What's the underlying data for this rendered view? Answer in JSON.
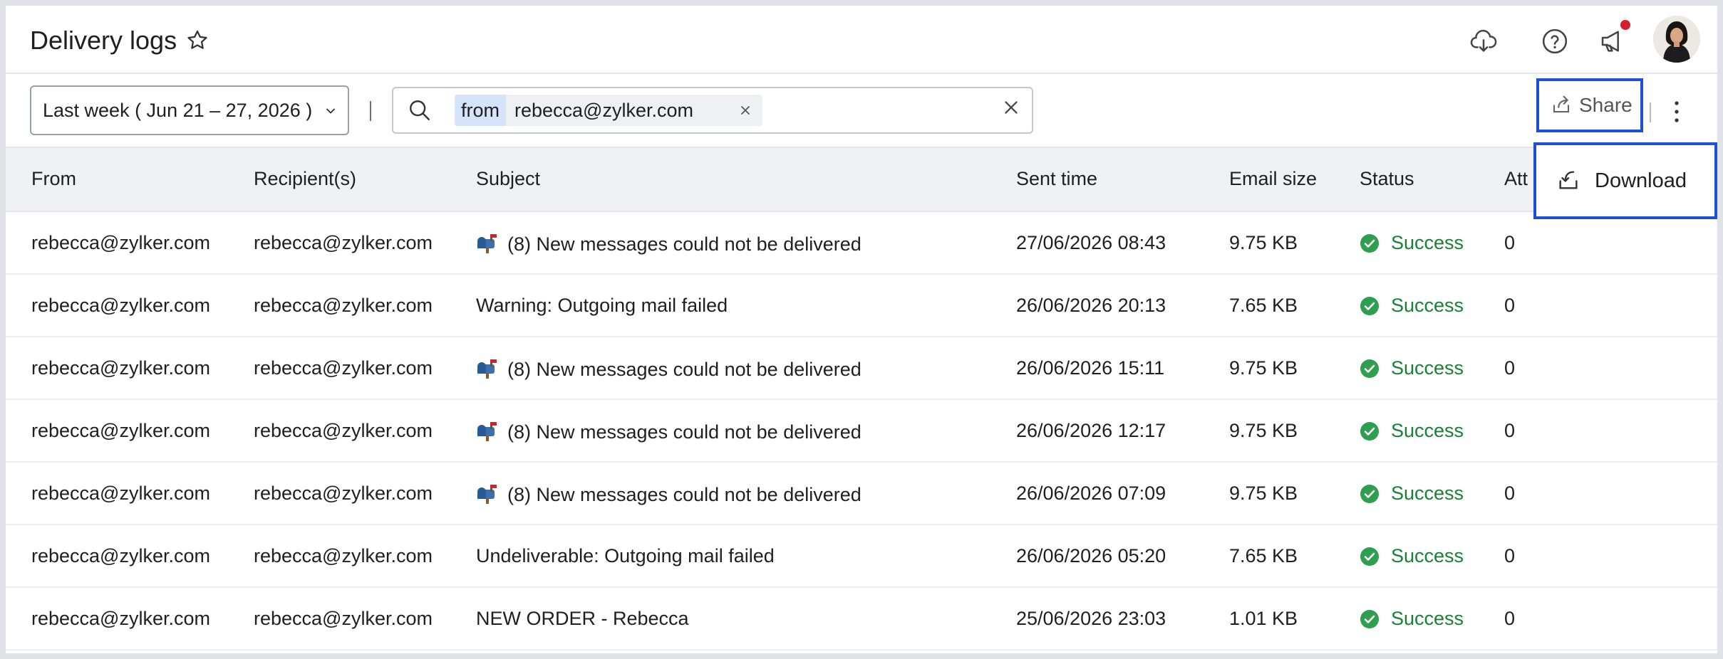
{
  "header": {
    "title": "Delivery logs",
    "icons": [
      "star-icon",
      "cloud-download-icon",
      "help-icon",
      "announcement-icon",
      "avatar"
    ],
    "notification_color": "#d3202a"
  },
  "toolbar": {
    "date_range": "Last week ( Jun 21 – 27, 2026 )",
    "search_chip_key": "from",
    "search_chip_value": "rebecca@zylker.com",
    "share_label": "Share",
    "accent_color": "#1f4fd8"
  },
  "menu": {
    "download_label": "Download"
  },
  "table": {
    "columns": [
      "From",
      "Recipient(s)",
      "Subject",
      "Sent time",
      "Email size",
      "Status",
      "Att"
    ],
    "rows": [
      {
        "from": "rebecca@zylker.com",
        "to": "rebecca@zylker.com",
        "icon": true,
        "subject": "(8) New messages could not be delivered",
        "time": "27/06/2026 08:43",
        "size": "9.75 KB",
        "status": "Success",
        "att": "0"
      },
      {
        "from": "rebecca@zylker.com",
        "to": "rebecca@zylker.com",
        "icon": false,
        "subject": "Warning: Outgoing mail failed",
        "time": "26/06/2026 20:13",
        "size": "7.65 KB",
        "status": "Success",
        "att": "0"
      },
      {
        "from": "rebecca@zylker.com",
        "to": "rebecca@zylker.com",
        "icon": true,
        "subject": "(8) New messages could not be delivered",
        "time": "26/06/2026 15:11",
        "size": "9.75 KB",
        "status": "Success",
        "att": "0"
      },
      {
        "from": "rebecca@zylker.com",
        "to": "rebecca@zylker.com",
        "icon": true,
        "subject": "(8) New messages could not be delivered",
        "time": "26/06/2026 12:17",
        "size": "9.75 KB",
        "status": "Success",
        "att": "0"
      },
      {
        "from": "rebecca@zylker.com",
        "to": "rebecca@zylker.com",
        "icon": true,
        "subject": "(8) New messages could not be delivered",
        "time": "26/06/2026 07:09",
        "size": "9.75 KB",
        "status": "Success",
        "att": "0"
      },
      {
        "from": "rebecca@zylker.com",
        "to": "rebecca@zylker.com",
        "icon": false,
        "subject": "Undeliverable: Outgoing mail failed",
        "time": "26/06/2026 05:20",
        "size": "7.65 KB",
        "status": "Success",
        "att": "0"
      },
      {
        "from": "rebecca@zylker.com",
        "to": "rebecca@zylker.com",
        "icon": false,
        "subject": "NEW ORDER - Rebecca",
        "time": "25/06/2026 23:03",
        "size": "1.01 KB",
        "status": "Success",
        "att": "0"
      }
    ],
    "status_color": "#1a7f37"
  }
}
